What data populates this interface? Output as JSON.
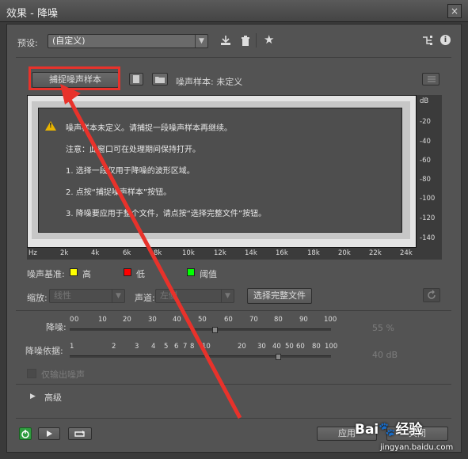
{
  "window": {
    "title": "效果 - 降噪",
    "close": "×"
  },
  "preset": {
    "label": "预设:",
    "value": "(自定义)"
  },
  "capture": {
    "button": "捕捉噪声样本",
    "status": "噪声样本: 未定义"
  },
  "message": {
    "line1": "噪声样本未定义。请捕捉一段噪声样本再继续。",
    "line2": "注意：此窗口可在处理期间保持打开。",
    "line3": "1. 选择一段仅用于降噪的波形区域。",
    "line4": "2. 点按“捕捉噪声样本”按钮。",
    "line5": "3. 降噪要应用于整个文件，请点按“选择完整文件”按钮。"
  },
  "db_axis": [
    "dB",
    "-20",
    "-40",
    "-60",
    "-80",
    "-100",
    "-120",
    "-140"
  ],
  "hz_axis": [
    "Hz",
    "2k",
    "4k",
    "6k",
    "8k",
    "10k",
    "12k",
    "14k",
    "16k",
    "18k",
    "20k",
    "22k",
    "24k"
  ],
  "legend": {
    "label": "噪声基准:",
    "items": [
      {
        "name": "高",
        "color": "#ffff00"
      },
      {
        "name": "低",
        "color": "#ff0000"
      },
      {
        "name": "阈值",
        "color": "#00ff00"
      }
    ]
  },
  "scale": {
    "label": "缩放:",
    "value": "线性"
  },
  "channel": {
    "label": "声道:",
    "value": "左侧"
  },
  "select_all": "选择完整文件",
  "reduction": {
    "label": "降噪:",
    "ticks": [
      "0",
      "0",
      "10",
      "20",
      "30",
      "40",
      "50",
      "60",
      "70",
      "80",
      "90",
      "100"
    ],
    "value": "55 %",
    "level_percent": 55
  },
  "reduce_by": {
    "label": "降噪依据:",
    "ticks": [
      "1",
      "2",
      "3",
      "4",
      "5",
      "6",
      "7",
      "8",
      "10",
      "20",
      "30",
      "40",
      "50",
      "60",
      "80",
      "100"
    ],
    "value": "40 dB",
    "level_db": 40
  },
  "output_noise_only": "仅输出噪声",
  "advanced": "高级",
  "apply": "应用",
  "close_btn": "关闭",
  "watermark": {
    "brand": "Bai",
    "brand2": "经验",
    "url": "jingyan.baidu.com"
  }
}
